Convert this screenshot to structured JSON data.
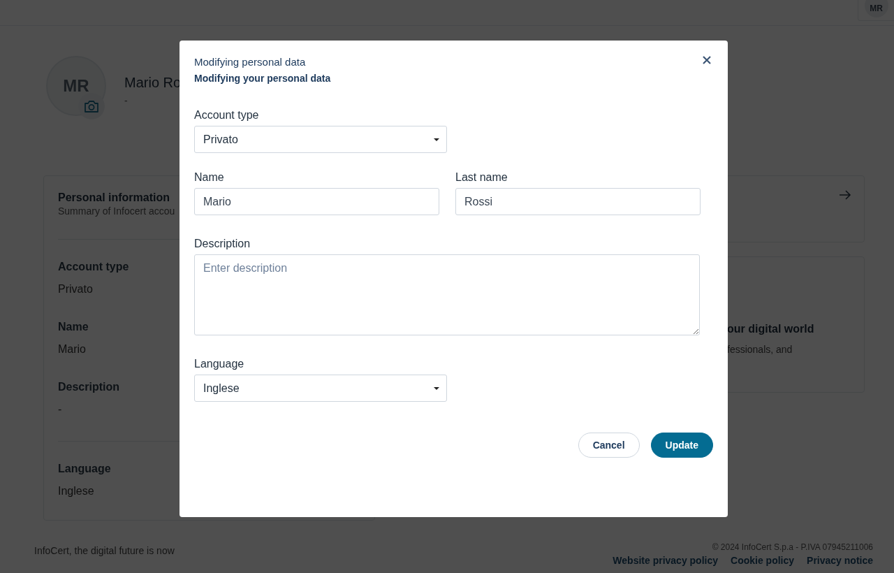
{
  "header": {
    "avatar_initials": "MR"
  },
  "profile": {
    "initials": "MR",
    "name": "Mario Ro",
    "subtitle": "-"
  },
  "info_card": {
    "title": "Personal information",
    "subtitle": "Summary of Infocert accou",
    "sections": [
      [
        {
          "label": "Account type",
          "value": "Privato"
        },
        {
          "label": "Name",
          "value": "Mario"
        },
        {
          "label": "Description",
          "value": "-"
        }
      ],
      [
        {
          "label": "Language",
          "value": "Inglese"
        }
      ]
    ]
  },
  "promo_card": {
    "title": "our digital world",
    "text": "fessionals, and"
  },
  "footer": {
    "tagline": "InfoCert, the digital future is now",
    "copyright": "© 2024 InfoCert S.p.a - P.IVA 07945211006",
    "links": [
      "Website privacy policy",
      "Cookie policy",
      "Privacy notice"
    ]
  },
  "dialog": {
    "title": "Modifying personal data",
    "subtitle": "Modifying your personal data",
    "account_type": {
      "label": "Account type",
      "value": "Privato"
    },
    "name": {
      "label": "Name",
      "value": "Mario"
    },
    "last_name": {
      "label": "Last name",
      "value": "Rossi"
    },
    "description": {
      "label": "Description",
      "placeholder": "Enter description"
    },
    "language": {
      "label": "Language",
      "value": "Inglese"
    },
    "buttons": [
      {
        "label": "Cancel",
        "kind": "secondary"
      },
      {
        "label": "Update",
        "kind": "primary"
      }
    ]
  }
}
